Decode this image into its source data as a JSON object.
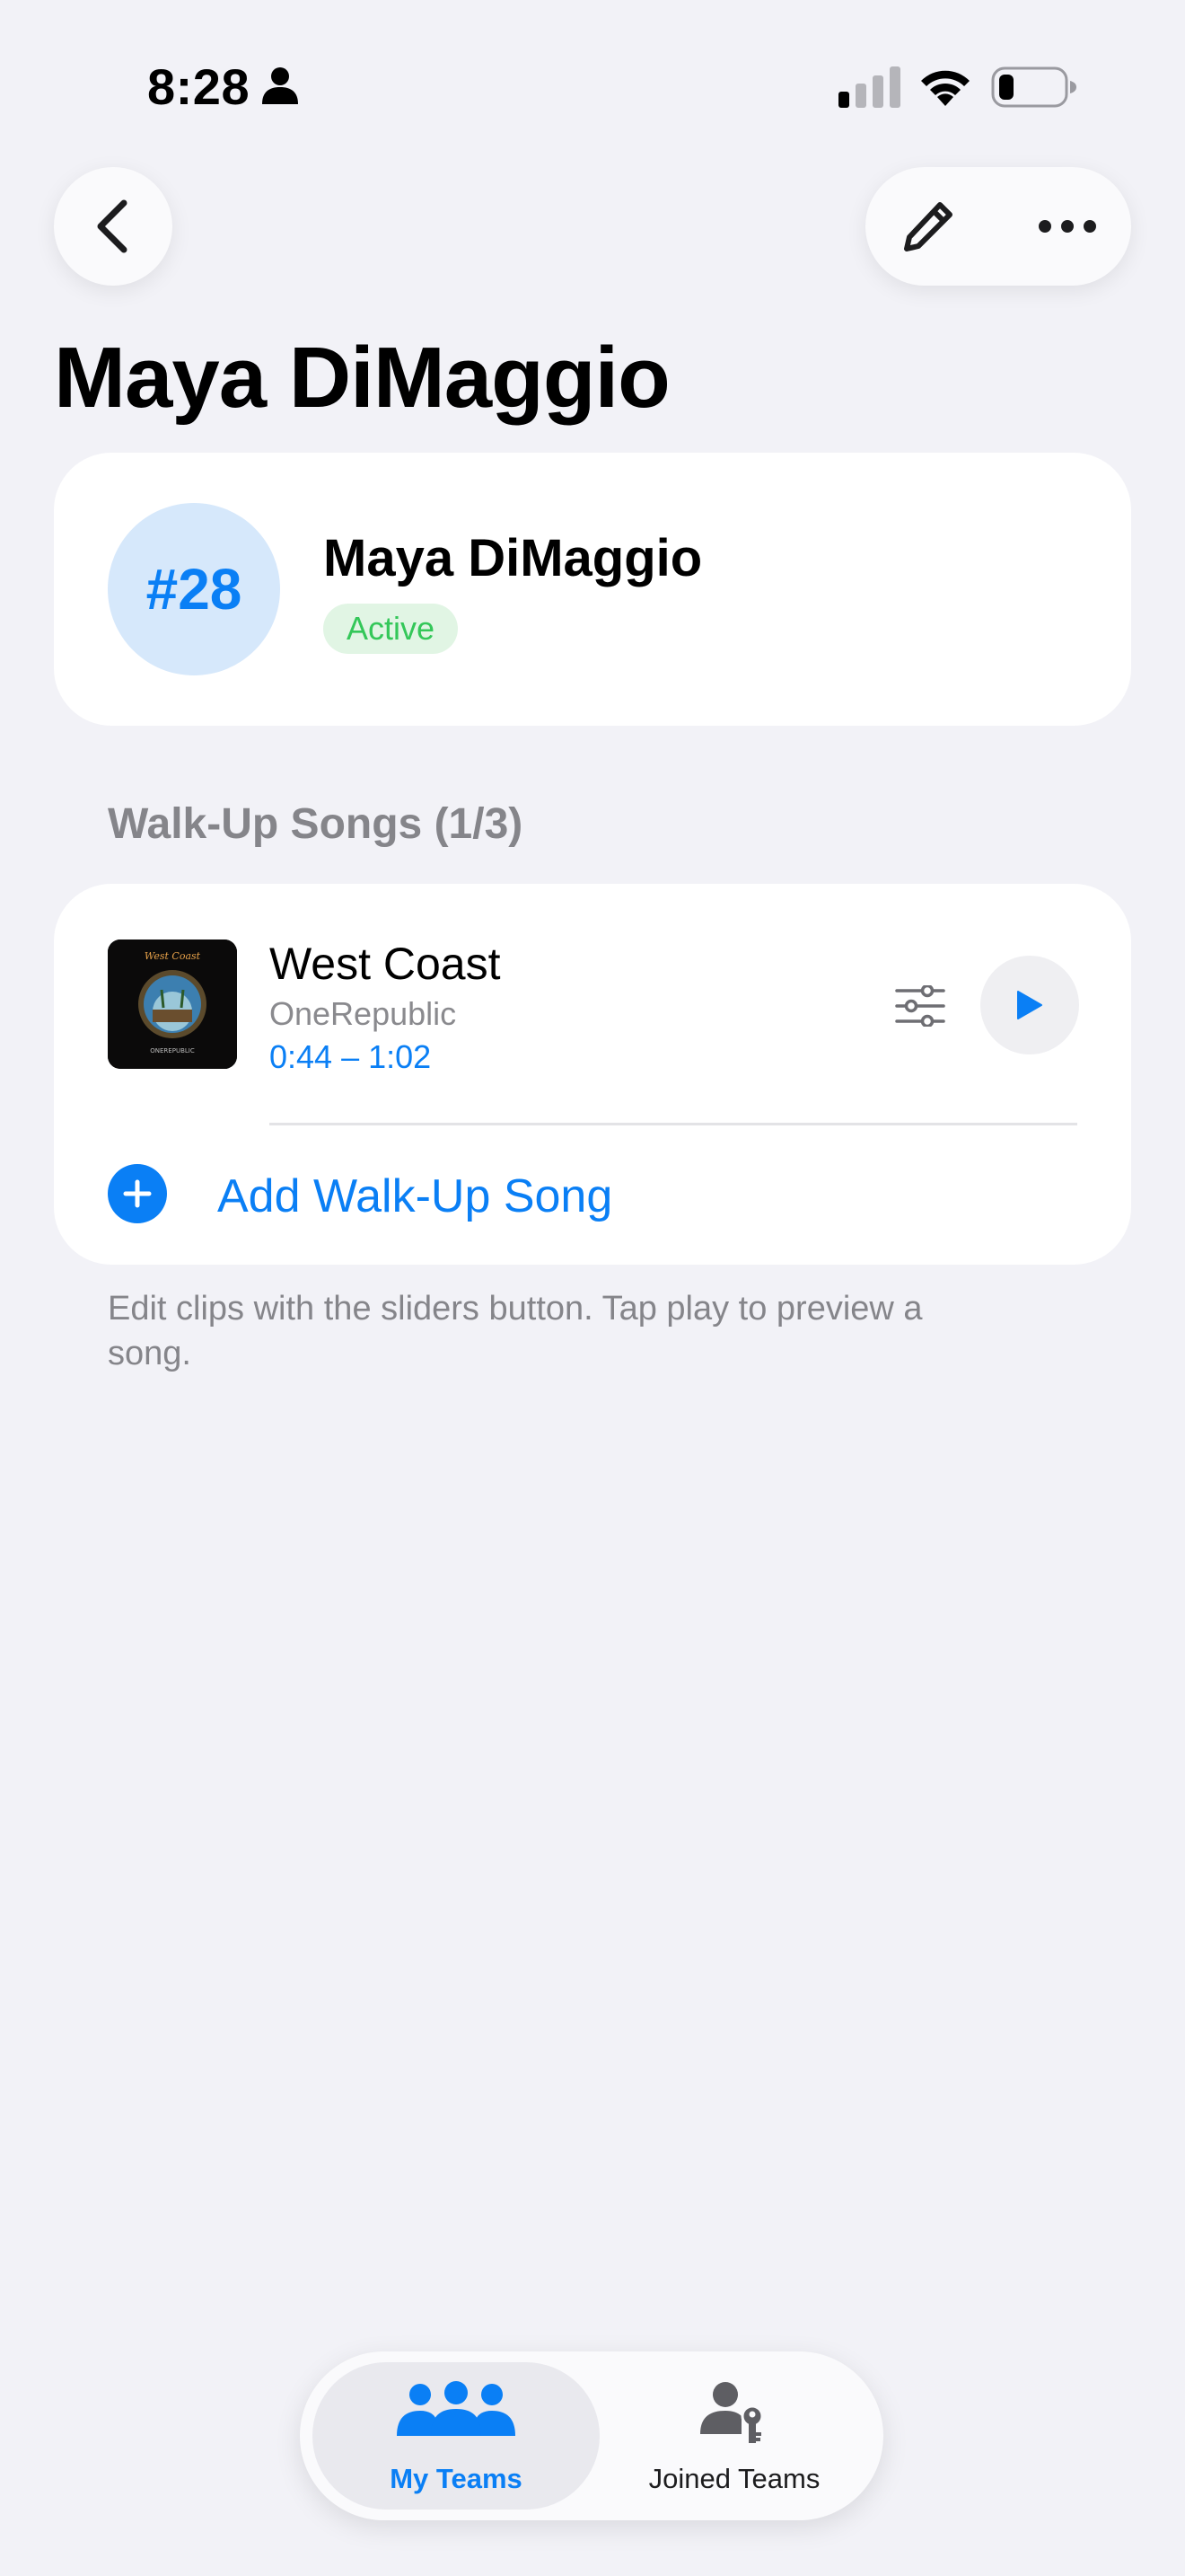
{
  "status_bar": {
    "time": "8:28",
    "icons": [
      "person-icon",
      "cellular-signal-icon",
      "wifi-icon",
      "battery-icon"
    ]
  },
  "nav": {
    "back_icon": "chevron-left-icon",
    "edit_icon": "pencil-icon",
    "more_icon": "ellipsis-icon"
  },
  "page_title": "Maya DiMaggio",
  "player": {
    "number": "#28",
    "name": "Maya DiMaggio",
    "status": "Active"
  },
  "walkup": {
    "header": "Walk-Up Songs (1/3)",
    "songs": [
      {
        "title": "West Coast",
        "artist": "OneRepublic",
        "clip": "0:44 – 1:02",
        "album_art_text": "West Coast",
        "album_art_subtext": "ONEREPUBLIC"
      }
    ],
    "add_label": "Add Walk-Up Song",
    "footer": "Edit clips with the sliders button. Tap play to preview a song."
  },
  "tabs": [
    {
      "label": "My Teams",
      "icon": "people-group-icon",
      "selected": true
    },
    {
      "label": "Joined Teams",
      "icon": "person-key-icon",
      "selected": false
    }
  ],
  "colors": {
    "accent": "#0A7FF5",
    "active_green": "#34C759",
    "background": "#F2F2F7",
    "secondary_text": "#85858A"
  }
}
